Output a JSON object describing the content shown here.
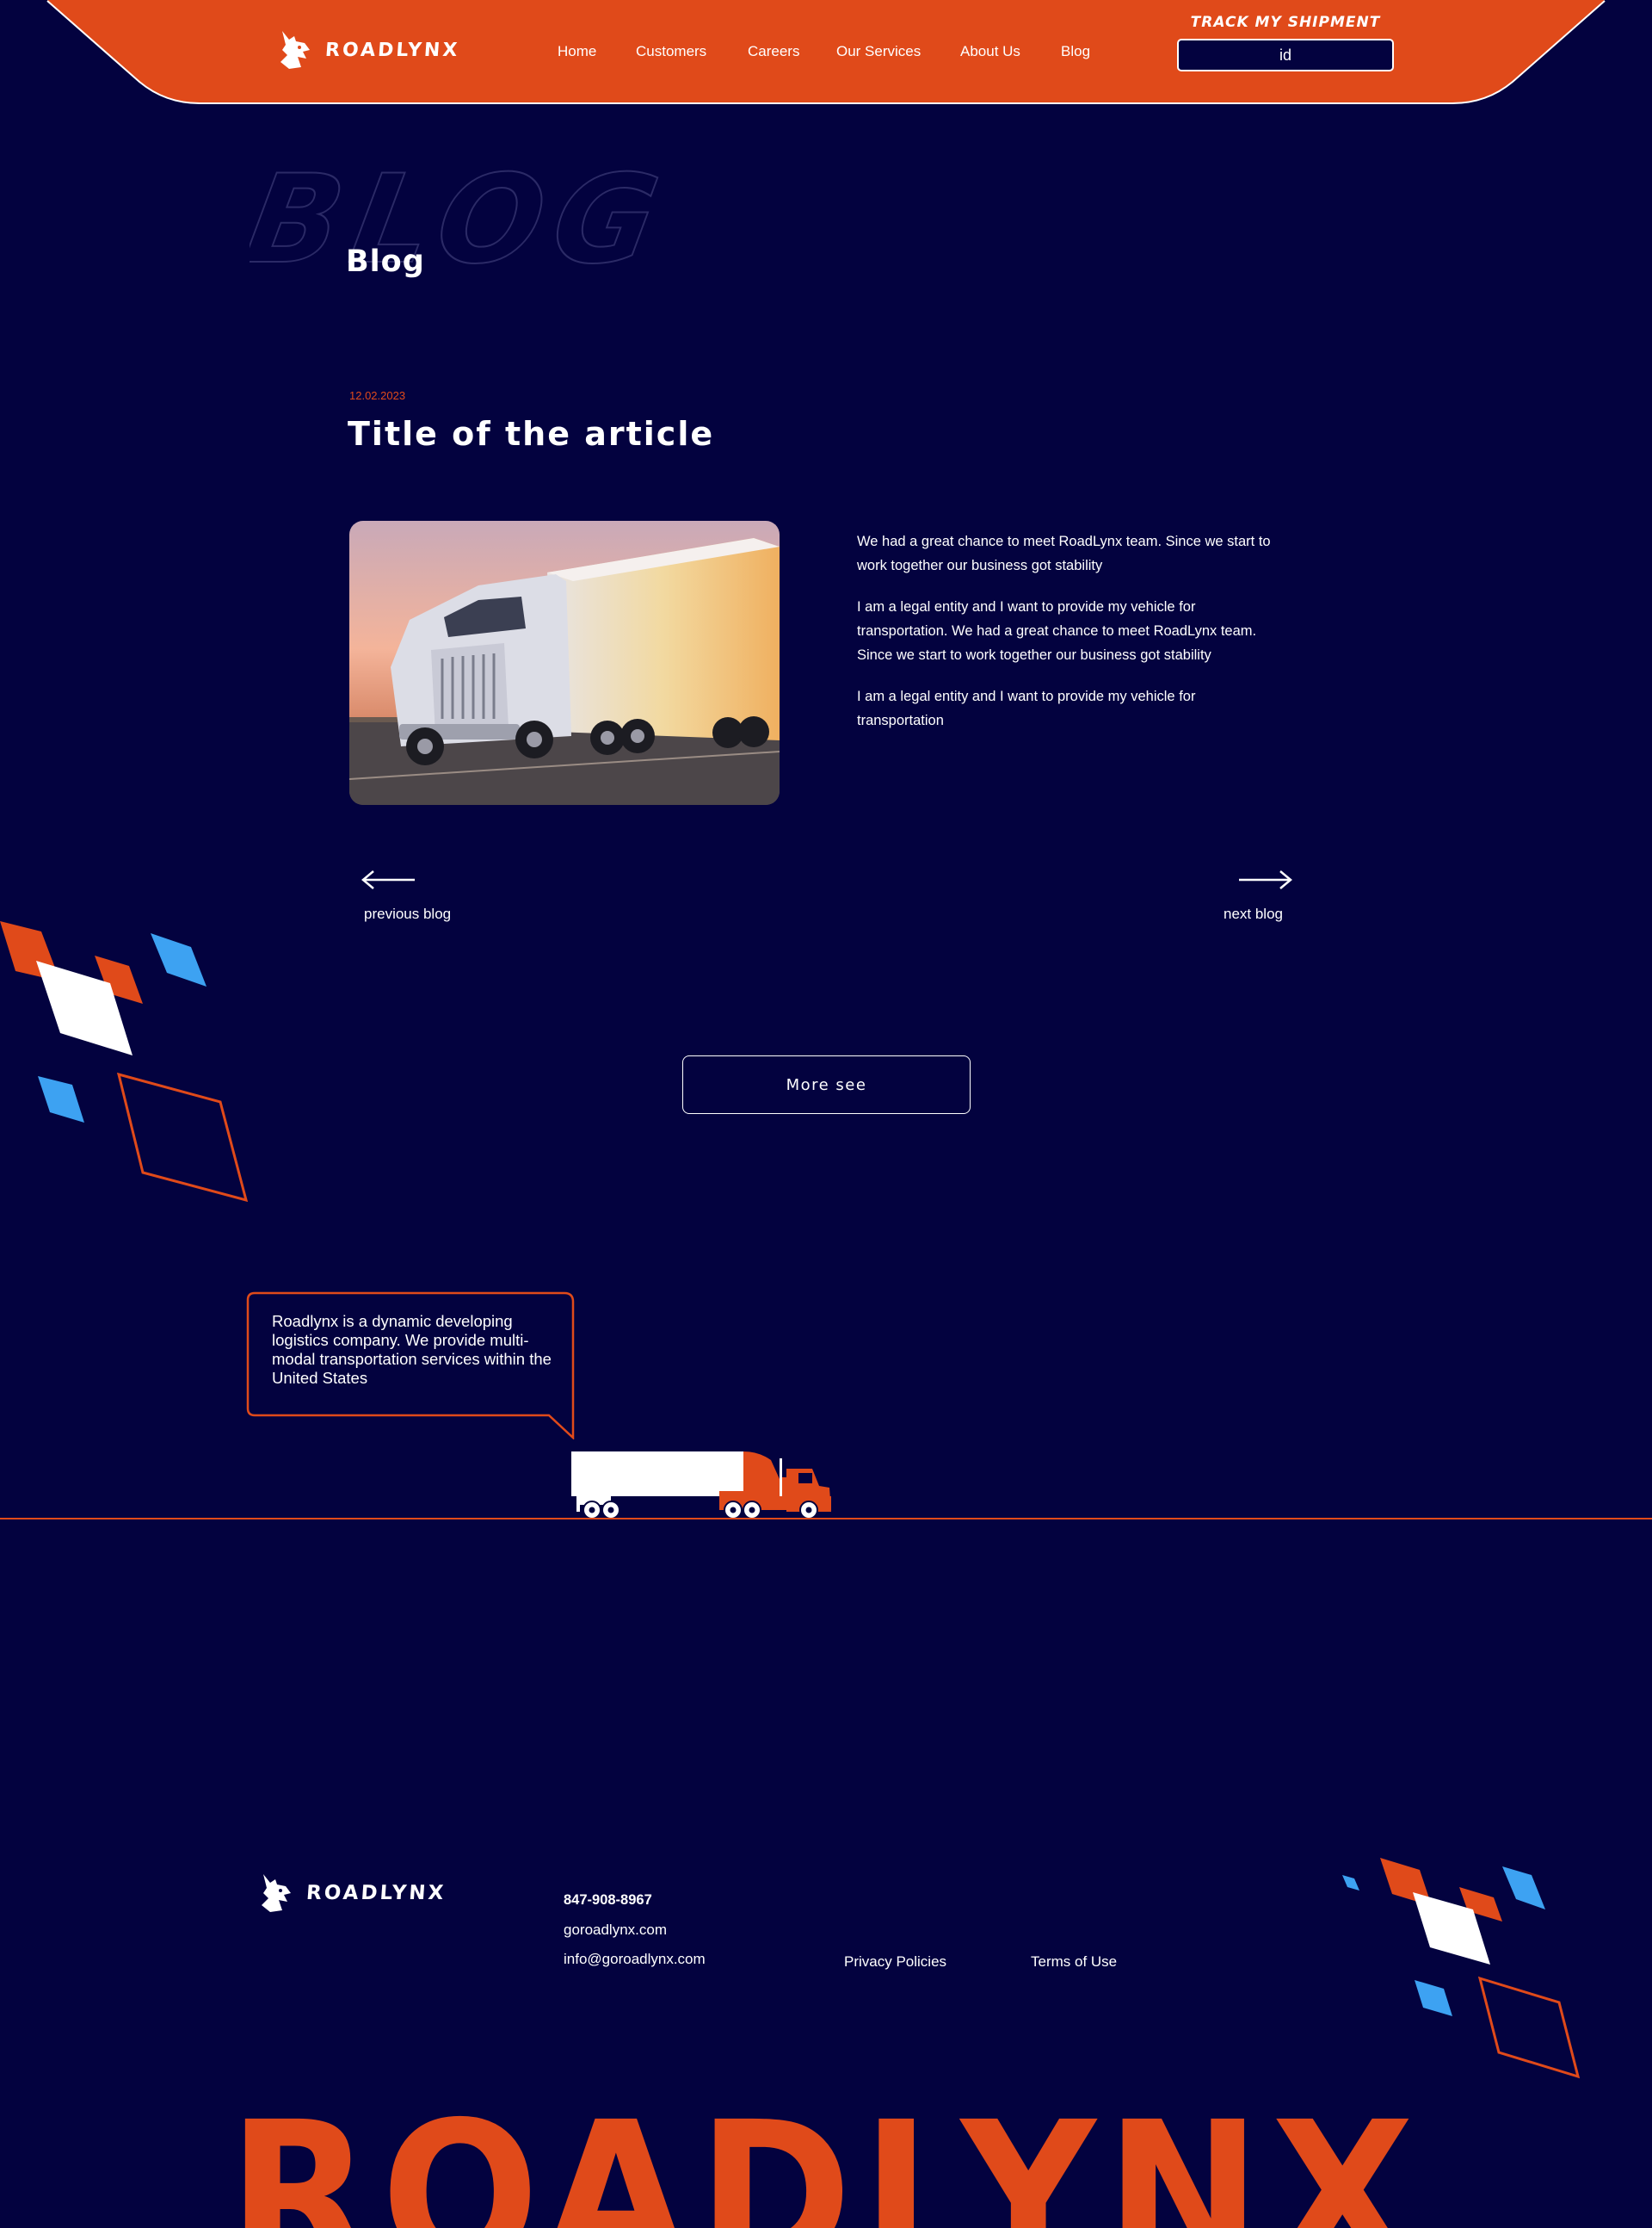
{
  "header": {
    "logo_text": "ROADLYNX",
    "nav": [
      "Home",
      "Customers",
      "Careers",
      "Our Services",
      "About Us",
      "Blog"
    ],
    "track_label": "TRACK MY SHIPMENT",
    "track_placeholder": "id"
  },
  "page": {
    "ghost_title": "BLOG",
    "title": "Blog"
  },
  "article": {
    "date": "12.02.2023",
    "title": "Title of the article",
    "image_alt": "White semi truck with trailer driving on highway at sunset",
    "paragraphs": [
      "We had a great chance to meet RoadLynx team. Since we start to work together our business got stability",
      "I am a legal entity and I want to provide my vehicle for transportation. We had a great chance to meet RoadLynx team. Since we start to work together our business got stability",
      "I am a legal entity and I want to provide my vehicle for transportation"
    ]
  },
  "pager": {
    "previous": "previous blog",
    "next": "next blog"
  },
  "more_button": "More see",
  "bubble": {
    "text": "Roadlynx is a dynamic developing logistics company. We provide multi-modal transportation services within the United States"
  },
  "footer": {
    "logo_text": "ROADLYNX",
    "phone": "847-908-8967",
    "website": "goroadlynx.com",
    "email": "info@goroadlynx.com",
    "privacy": "Privacy Policies",
    "terms": "Terms of Use",
    "big_wordmark": "ROADLYNX"
  },
  "colors": {
    "background": "#03023f",
    "accent_orange": "#e04a1a",
    "accent_blue": "#3da2f2",
    "white": "#ffffff"
  }
}
